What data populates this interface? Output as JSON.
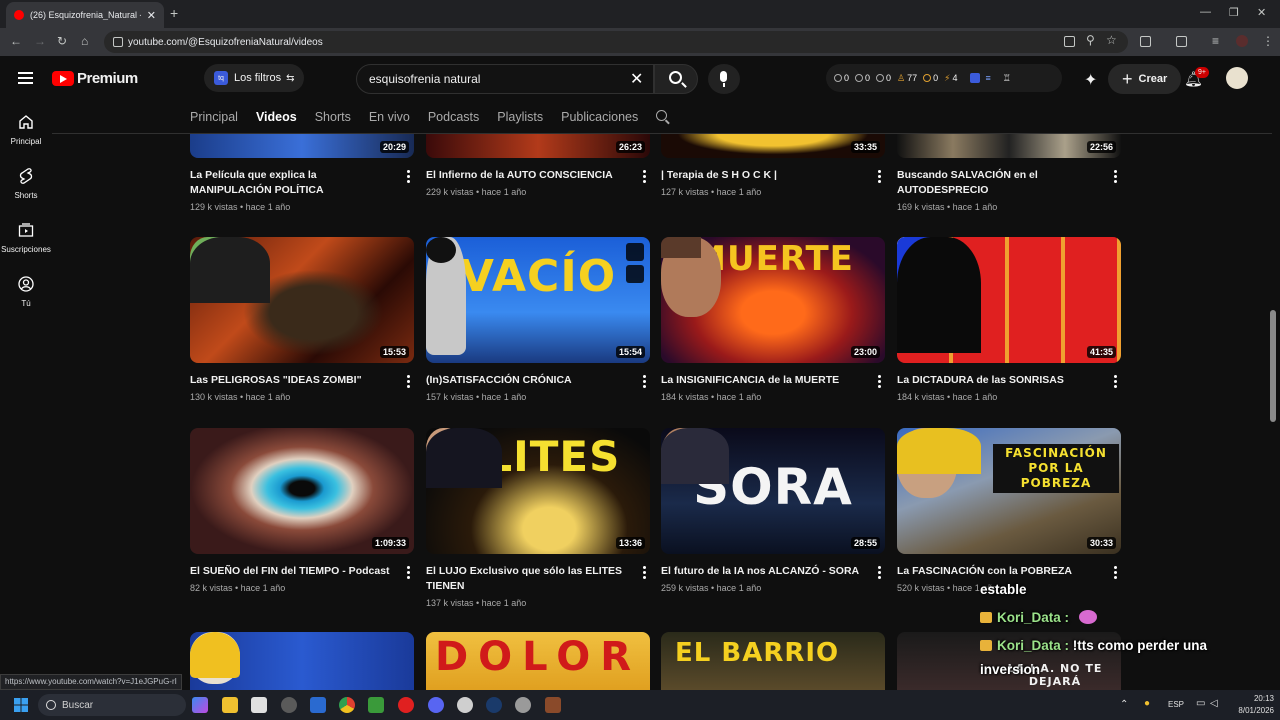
{
  "browser": {
    "tab_title": "(26) Esquizofrenia_Natural - Yo",
    "url": "youtube.com/@EsquizofreniaNatural/videos"
  },
  "header": {
    "logo_text": "Premium",
    "filters_badge": "tq",
    "filters_label": "Los filtros",
    "search_value": "esquisofrenia natural",
    "stats": [
      "0",
      "0",
      "0",
      "77",
      "0",
      "4"
    ],
    "create_label": "Crear",
    "notif_badge": "9+"
  },
  "sidebar": {
    "items": [
      {
        "label": "Principal",
        "icon": "home-icon"
      },
      {
        "label": "Shorts",
        "icon": "shorts-icon"
      },
      {
        "label": "Suscripciones",
        "icon": "subscriptions-icon"
      },
      {
        "label": "Tú",
        "icon": "you-icon"
      }
    ]
  },
  "tabs": [
    "Principal",
    "Videos",
    "Shorts",
    "En vivo",
    "Podcasts",
    "Playlists",
    "Publicaciones"
  ],
  "videos": [
    {
      "title": "La Película que explica la MANIPULACIÓN POLÍTICA",
      "meta": "129 k vistas • hace 1 año",
      "duration": "20:29"
    },
    {
      "title": "El Infierno de la AUTO CONSCIENCIA",
      "meta": "229 k vistas • hace 1 año",
      "duration": "26:23"
    },
    {
      "title": "| Terapia de S H O C K |",
      "meta": "127 k vistas • hace 1 año",
      "duration": "33:35"
    },
    {
      "title": "Buscando SALVACIÓN en el AUTODESPRECIO",
      "meta": "169 k vistas • hace 1 año",
      "duration": "22:56"
    },
    {
      "title": "Las PELIGROSAS \"IDEAS ZOMBI\"",
      "meta": "130 k vistas • hace 1 año",
      "duration": "15:53"
    },
    {
      "title": "(In)SATISFACCIÓN CRÓNICA",
      "meta": "157 k vistas • hace 1 año",
      "duration": "15:54",
      "thumb_text": "VACÍO"
    },
    {
      "title": "La INSIGNIFICANCIA de la MUERTE",
      "meta": "184 k vistas • hace 1 año",
      "duration": "23:00",
      "thumb_text": "MUERTE"
    },
    {
      "title": "La DICTADURA de las SONRISAS",
      "meta": "184 k vistas • hace 1 año",
      "duration": "41:35"
    },
    {
      "title": "El SUEÑO del FIN del TIEMPO - Podcast",
      "meta": "82 k vistas • hace 1 año",
      "duration": "1:09:33"
    },
    {
      "title": "El LUJO Exclusivo que sólo las ELITES TIENEN",
      "meta": "137 k vistas • hace 1 año",
      "duration": "13:36",
      "thumb_text": "ELITES"
    },
    {
      "title": "El futuro de la IA nos ALCANZÓ - SORA",
      "meta": "259 k vistas • hace 1 año",
      "duration": "28:55",
      "thumb_text": "SORA"
    },
    {
      "title": "La FASCINACIÓN con la POBREZA",
      "meta": "520 k vistas • hace 1 año",
      "duration": "30:33",
      "thumb_text": "FASCINACIÓN POR LA POBREZA"
    },
    {
      "thumb_text": ""
    },
    {
      "thumb_text": "DOLOR"
    },
    {
      "thumb_text": "EL BARRIO"
    },
    {
      "thumb_text": "LA I.A. NO TE DEJARÁ"
    }
  ],
  "chat": {
    "line1": "estable",
    "user1": "Kori_Data :",
    "user2": "Kori_Data :",
    "msg2a": "!tts como perder una",
    "msg2b": "inversion"
  },
  "status_url": "https://www.youtube.com/watch?v=J1eJGPuG-rI",
  "taskbar": {
    "search_label": "Buscar",
    "lang": "ESP",
    "time": "20:13",
    "date": "8/01/2026"
  },
  "colors": {
    "accent_red": "#ff0000",
    "page_bg": "#0f0f0f"
  }
}
